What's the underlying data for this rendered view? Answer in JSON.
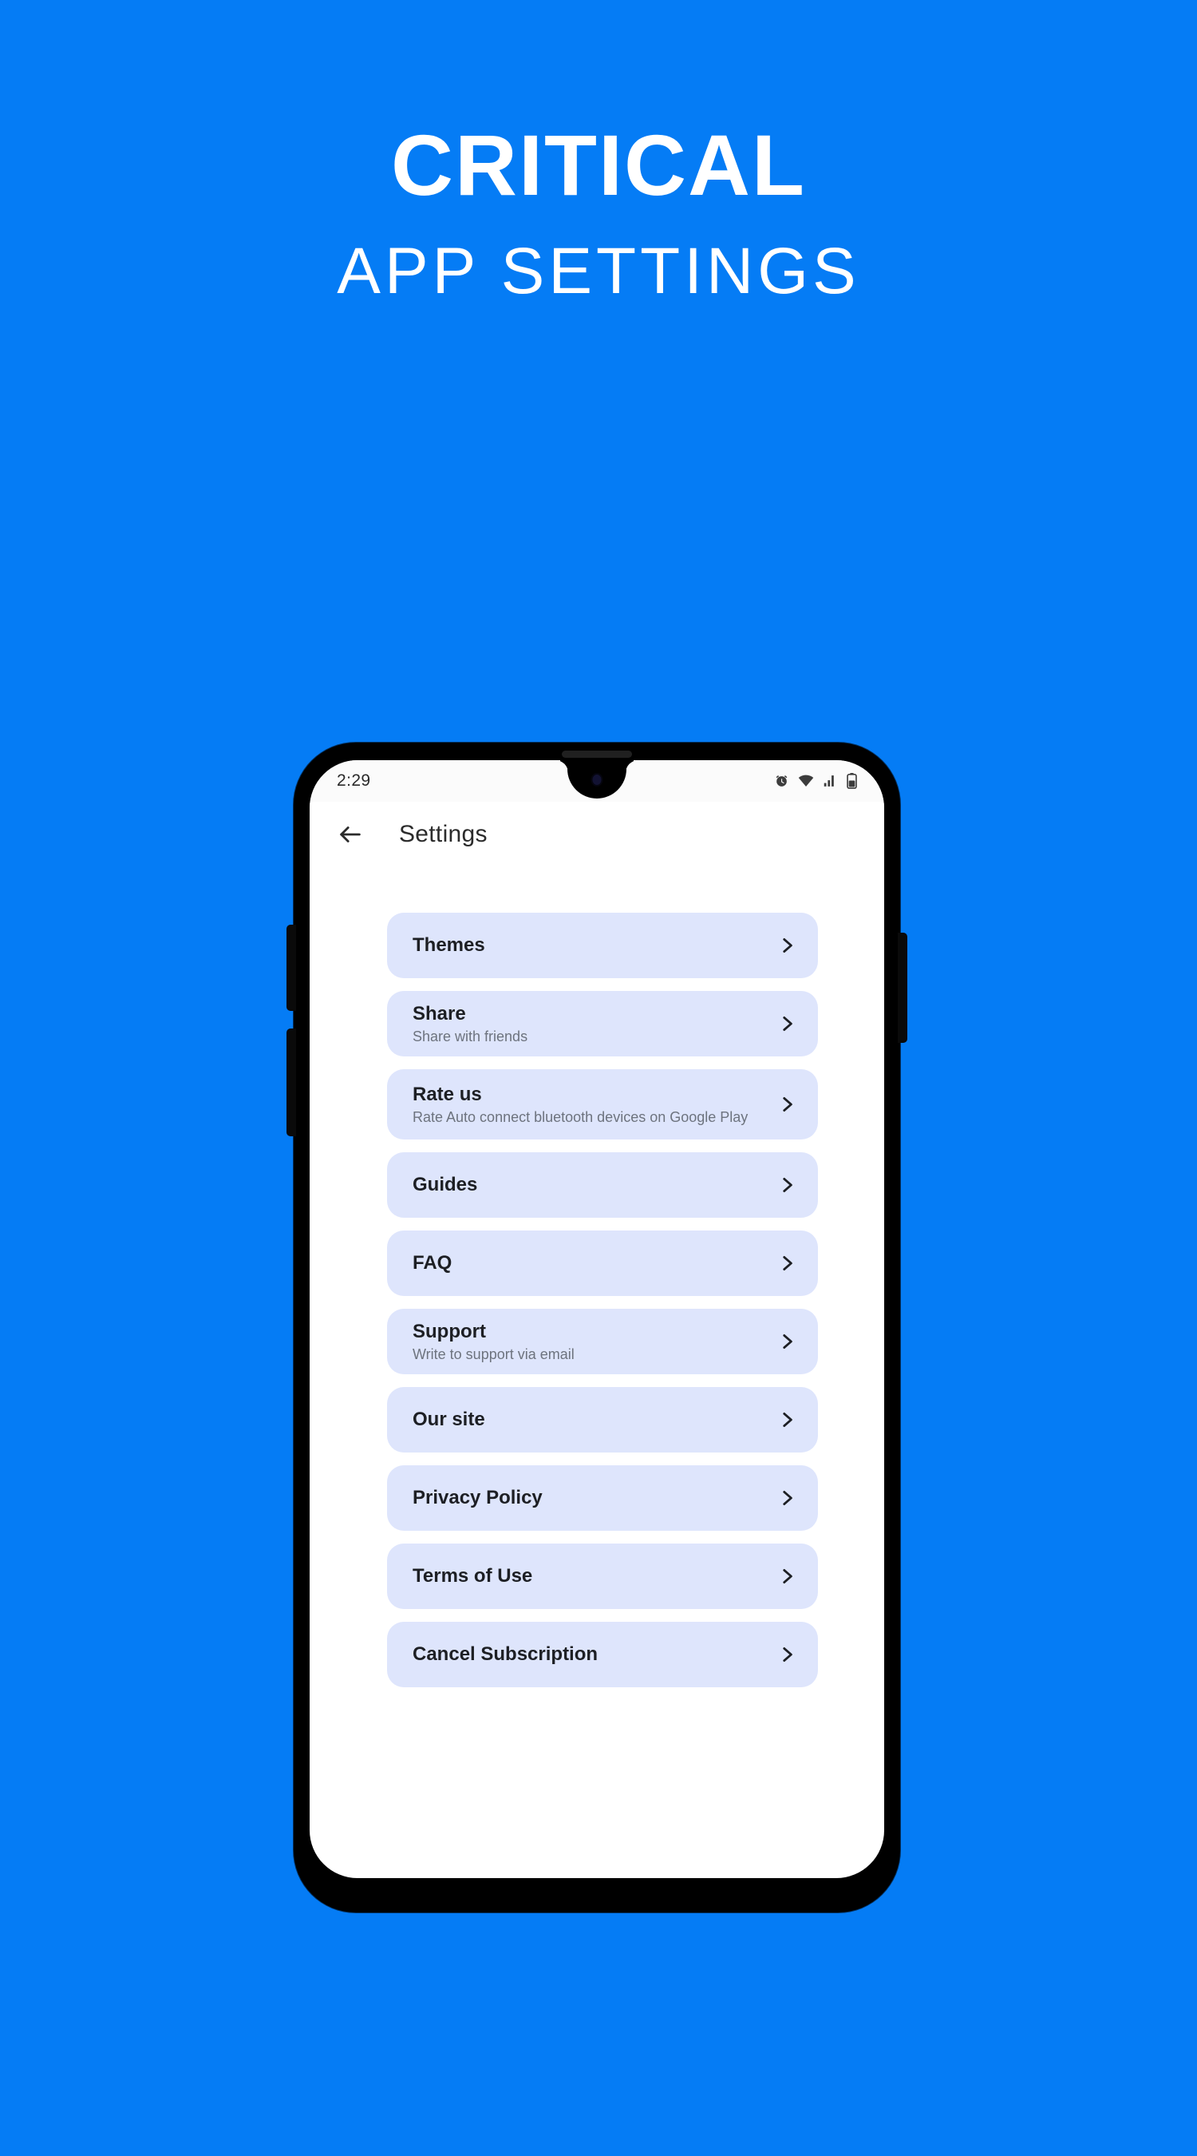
{
  "headline": {
    "line1": "CRITICAL",
    "line2": "APP SETTINGS"
  },
  "colors": {
    "background": "#057CF5",
    "card": "#DEE5FC",
    "card_title": "#1D1F24",
    "card_subtitle": "#6D737E",
    "device_frame": "#000000",
    "screen": "#FFFFFF"
  },
  "phone": {
    "statusbar": {
      "time": "2:29",
      "icons": [
        "alarm-icon",
        "wifi-icon",
        "signal-icon",
        "battery-icon"
      ]
    },
    "appbar": {
      "back_icon": "back-arrow-icon",
      "title": "Settings"
    },
    "settings": {
      "chevron_icon": "chevron-right-icon",
      "items": [
        {
          "title": "Themes",
          "subtitle": ""
        },
        {
          "title": "Share",
          "subtitle": "Share with friends"
        },
        {
          "title": "Rate us",
          "subtitle": "Rate Auto connect bluetooth devices on Google Play"
        },
        {
          "title": "Guides",
          "subtitle": ""
        },
        {
          "title": "FAQ",
          "subtitle": ""
        },
        {
          "title": "Support",
          "subtitle": "Write to support via email"
        },
        {
          "title": "Our site",
          "subtitle": ""
        },
        {
          "title": "Privacy Policy",
          "subtitle": ""
        },
        {
          "title": "Terms of Use",
          "subtitle": ""
        },
        {
          "title": "Cancel Subscription",
          "subtitle": ""
        }
      ]
    }
  }
}
